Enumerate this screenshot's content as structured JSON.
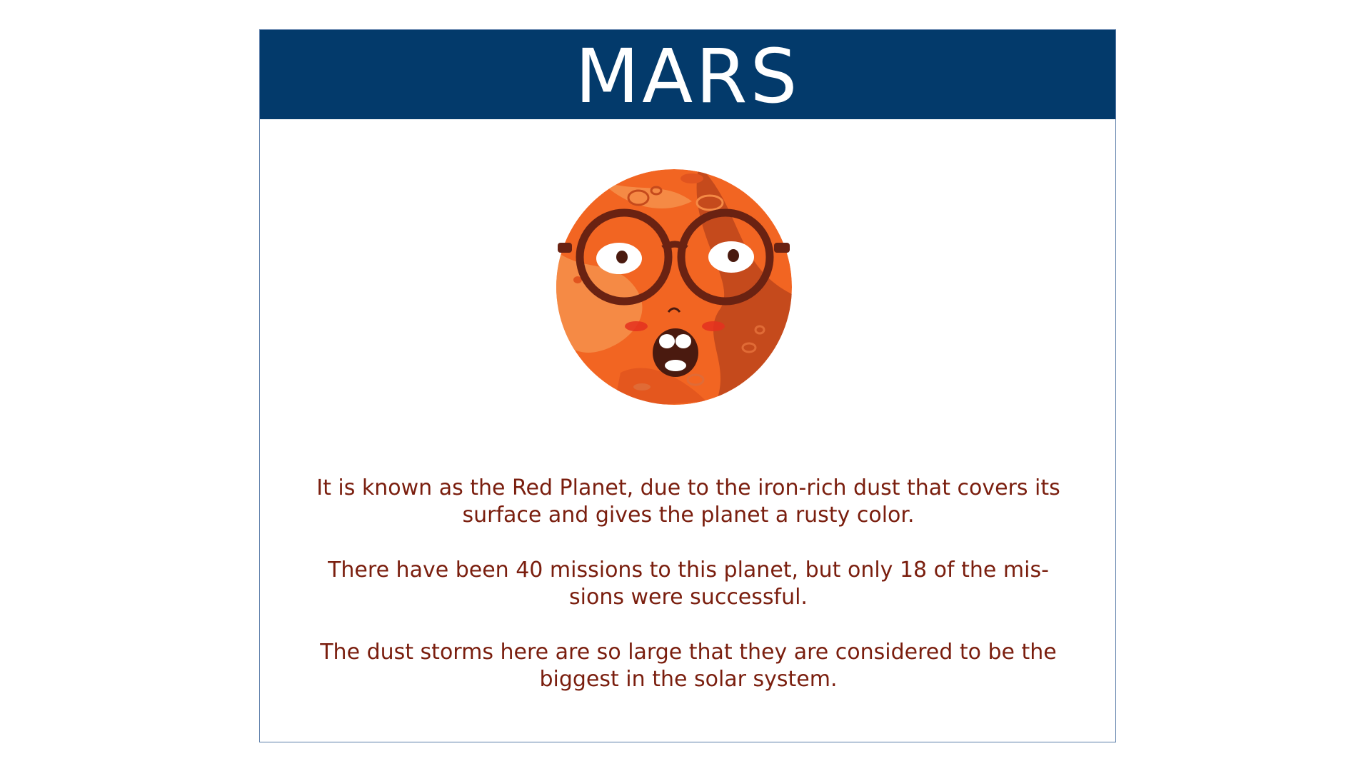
{
  "slide": {
    "title": "MARS",
    "colors": {
      "title_bar": "#033a6b",
      "title_text": "#ffffff",
      "body_text": "#7a1e0e",
      "border": "#5a7ca8",
      "planet_main": "#f26522",
      "planet_dark": "#c54a1c",
      "planet_light": "#f58a45"
    },
    "illustration": {
      "icon": "cartoon-mars-with-glasses"
    },
    "facts": [
      "It is known as the Red Planet, due to the iron-rich dust that covers its surface and gives the planet a rusty color.",
      "There have been 40 missions to this planet, but only 18 of the mis-sions were successful.",
      "The dust storms here are so large that they are considered to be the biggest in the solar system."
    ]
  }
}
